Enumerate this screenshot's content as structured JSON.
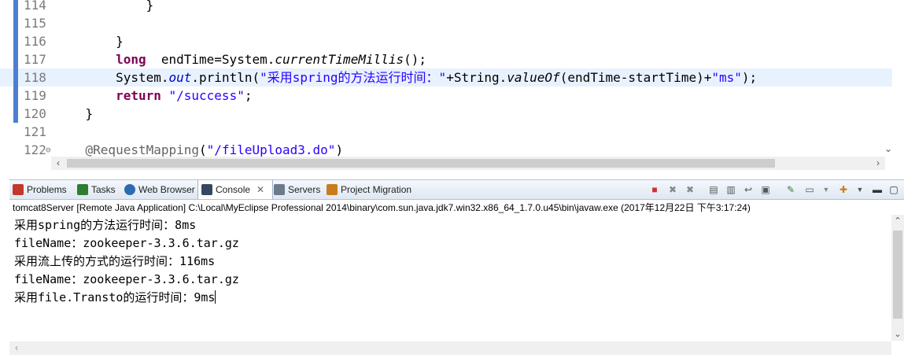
{
  "editor": {
    "lines": [
      {
        "num": "114",
        "indent": "            ",
        "parts": [
          {
            "t": "}",
            "c": ""
          }
        ]
      },
      {
        "num": "115",
        "indent": "",
        "parts": []
      },
      {
        "num": "116",
        "indent": "        ",
        "parts": [
          {
            "t": "}",
            "c": ""
          }
        ]
      },
      {
        "num": "117",
        "indent": "        ",
        "parts": [
          {
            "t": "long",
            "c": "kw"
          },
          {
            "t": "  endTime=System.",
            "c": ""
          },
          {
            "t": "currentTimeMillis",
            "c": "itl"
          },
          {
            "t": "();",
            "c": ""
          }
        ]
      },
      {
        "num": "118",
        "indent": "        ",
        "parts": [
          {
            "t": "System.",
            "c": ""
          },
          {
            "t": "out",
            "c": "fld"
          },
          {
            "t": ".println(",
            "c": ""
          },
          {
            "t": "\"采用spring的方法运行时间：\"",
            "c": "str"
          },
          {
            "t": "+String.",
            "c": ""
          },
          {
            "t": "valueOf",
            "c": "itl"
          },
          {
            "t": "(endTime-startTime)+",
            "c": ""
          },
          {
            "t": "\"ms\"",
            "c": "str"
          },
          {
            "t": ");",
            "c": ""
          }
        ]
      },
      {
        "num": "119",
        "indent": "        ",
        "parts": [
          {
            "t": "return",
            "c": "kw"
          },
          {
            "t": " ",
            "c": ""
          },
          {
            "t": "\"/success\"",
            "c": "str"
          },
          {
            "t": ";",
            "c": ""
          }
        ]
      },
      {
        "num": "120",
        "indent": "    ",
        "parts": [
          {
            "t": "}",
            "c": ""
          }
        ]
      },
      {
        "num": "121",
        "indent": "",
        "parts": []
      },
      {
        "num": "122",
        "indent": "    ",
        "parts": [
          {
            "t": "@RequestMapping",
            "c": "ann"
          },
          {
            "t": "(",
            "c": ""
          },
          {
            "t": "\"/fileUpload3.do\"",
            "c": "str"
          },
          {
            "t": ")",
            "c": ""
          }
        ]
      }
    ],
    "highlighted_line": "118",
    "fold_marker_line": "122"
  },
  "console": {
    "tabs": [
      {
        "label": "Problems",
        "icon": "problems-icon",
        "color": "#c0392b"
      },
      {
        "label": "Tasks",
        "icon": "tasks-icon",
        "color": "#2e7d32"
      },
      {
        "label": "Web Browser",
        "icon": "globe-icon",
        "color": "#2b6cb0"
      },
      {
        "label": "Console",
        "icon": "console-icon",
        "color": "#34495e"
      },
      {
        "label": "Servers",
        "icon": "servers-icon",
        "color": "#6b7b8c"
      },
      {
        "label": "Project Migration",
        "icon": "migration-icon",
        "color": "#c77d1c"
      }
    ],
    "active_tab": "Console",
    "launch": "tomcat8Server [Remote Java Application] C:\\Local\\MyEclipse Professional 2014\\binary\\com.sun.java.jdk7.win32.x86_64_1.7.0.u45\\bin\\javaw.exe (2017年12月22日 下午3:17:24)",
    "output": [
      "采用spring的方法运行时间：8ms",
      "fileName：zookeeper-3.3.6.tar.gz",
      "采用流上传的方式的运行时间：116ms",
      "fileName：zookeeper-3.3.6.tar.gz",
      "采用file.Transto的运行时间：9ms"
    ]
  },
  "colors": {
    "keyword": "#7f0055",
    "string": "#2a00ff",
    "highlight": "#e8f2fe",
    "terminate": "#d32f2f"
  }
}
